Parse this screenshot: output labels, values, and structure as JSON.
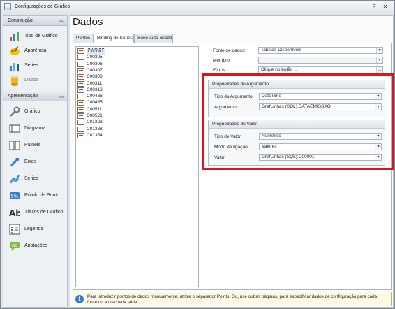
{
  "window": {
    "title": "Configurações de Gráfico",
    "help_glyph": "?",
    "close_glyph": "✕"
  },
  "sidebar": {
    "group1": {
      "label": "Construção",
      "chevron": "︽"
    },
    "group1_items": [
      {
        "label": "Tipo de Gráfico",
        "icon": "chart-type-icon"
      },
      {
        "label": "Aparência",
        "icon": "palette-icon"
      },
      {
        "label": "Séries",
        "icon": "series-icon"
      },
      {
        "label": "Dados",
        "icon": "data-cylinder-icon"
      }
    ],
    "group2": {
      "label": "Apresentação",
      "chevron": "︽"
    },
    "group2_items": [
      {
        "label": "Gráfico",
        "icon": "wrench-icon"
      },
      {
        "label": "Diagrama",
        "icon": "diagram-icon"
      },
      {
        "label": "Painéis",
        "icon": "panels-icon"
      },
      {
        "label": "Eixos",
        "icon": "axes-icon"
      },
      {
        "label": "Séries",
        "icon": "series-icon"
      },
      {
        "label": "Rótulo de Ponto",
        "icon": "point-label-icon"
      },
      {
        "label": "Títulos de Gráfico",
        "icon": "titles-icon"
      },
      {
        "label": "Legenda",
        "icon": "legend-icon"
      },
      {
        "label": "Anotações",
        "icon": "annotation-icon"
      }
    ]
  },
  "main": {
    "title": "Dados",
    "tabs": [
      "Pontos",
      "Binding de Séries",
      "Série auto-criada"
    ],
    "series_list": [
      "C00001",
      "C00305",
      "C00306",
      "C00307",
      "C00308",
      "C00311",
      "C00318",
      "C00436",
      "C00455",
      "C00511",
      "C00521",
      "C01323",
      "C01338",
      "C01354"
    ],
    "selected_series": "C00001",
    "form": {
      "datasource_label": "Fonte de dados:",
      "datasource_value": "Tabelas Disponíveis",
      "member_label": "Membro:",
      "member_value": "",
      "filters_label": "Filtros:",
      "filters_value": "Clique no botão ...",
      "filters_button": "..."
    },
    "argument_group": {
      "title": "Propriedades do Argumento",
      "type_label": "Tipo do Argumento:",
      "type_value": "DateTime",
      "arg_label": "Argumento:",
      "arg_value": "GrafLinhas (SQL).DATAEMISSAO"
    },
    "value_group": {
      "title": "Propriedades do Valor",
      "type_label": "Tipo do Valor:",
      "type_value": "Numérico",
      "mode_label": "Modo de ligação:",
      "mode_value": "Valores",
      "value_label": "Valor:",
      "value_value": "GrafLinhas (SQL).C00001"
    },
    "info": "Para introduzir pontos de dados manualmente, utilize o separador Points. Ou, use outras páginas, para especificar dados de configuração para cada fonte ou auto-criada série."
  },
  "colors": {
    "highlight": "#e0141e",
    "accent": "#2f7ed8"
  }
}
